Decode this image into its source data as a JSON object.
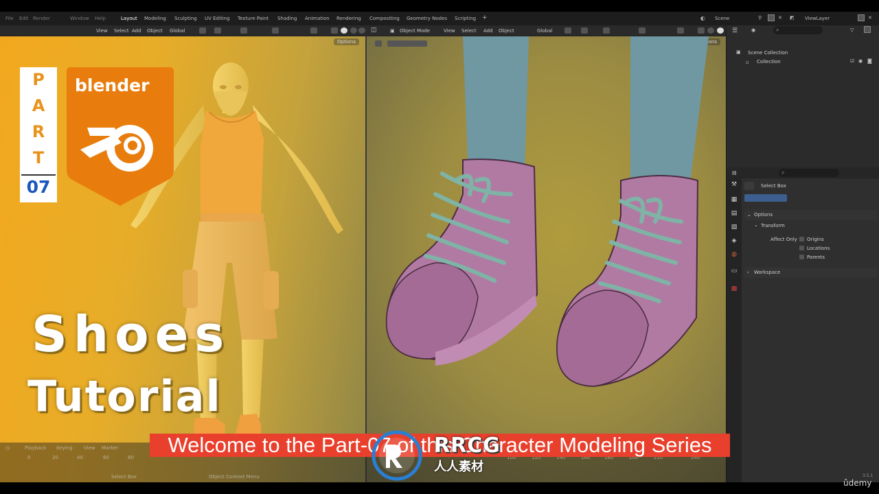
{
  "workspace_tabs": [
    "Layout",
    "Modeling",
    "Sculpting",
    "UV Editing",
    "Texture Paint",
    "Shading",
    "Animation",
    "Rendering",
    "Compositing",
    "Geometry Nodes",
    "Scripting"
  ],
  "scene": {
    "label": "Scene",
    "view_layer": "ViewLayer"
  },
  "left_header": {
    "items": [
      "View",
      "Select",
      "Add",
      "Object"
    ],
    "transform": "Global",
    "options": "Options"
  },
  "right_header": {
    "mode": "Object Mode",
    "items": [
      "View",
      "Select",
      "Add",
      "Object"
    ],
    "transform": "Global",
    "options": "Options"
  },
  "outliner": {
    "scene_collection": "Scene Collection",
    "collection": "Collection"
  },
  "properties": {
    "tool": "Select Box",
    "options": "Options",
    "transform": "Transform",
    "affect_only": "Affect Only",
    "checks": [
      "Origins",
      "Locations",
      "Parents"
    ],
    "workspace": "Workspace"
  },
  "timeline": {
    "items": [
      "Playback",
      "Keying",
      "View",
      "Marker"
    ],
    "frames": [
      "0",
      "20",
      "40",
      "60",
      "80",
      "100",
      "120",
      "140",
      "160",
      "180",
      "200",
      "220",
      "240"
    ],
    "status_left": "Select Box",
    "status_mid": "Object Context Menu"
  },
  "thumbnail": {
    "part_letters": [
      "P",
      "A",
      "R",
      "T"
    ],
    "part_number": "07",
    "logo_text": "blender",
    "title_line1": "Shoes",
    "title_line2": "Tutorial",
    "subtitle": "Welcome to the Part-07 of this Character Modeling Series"
  },
  "watermark": {
    "main": "RRCG",
    "sub": "人人素材"
  },
  "brand": {
    "udemy": "ûdemy",
    "version": "3.5.1"
  },
  "colors": {
    "orange": "#e8931c",
    "blue": "#1a56c0",
    "subtitle_bg": "#e8402c",
    "shoe": "#b17aa3",
    "lace": "#7fb3a6",
    "sock": "#6f98a3"
  }
}
